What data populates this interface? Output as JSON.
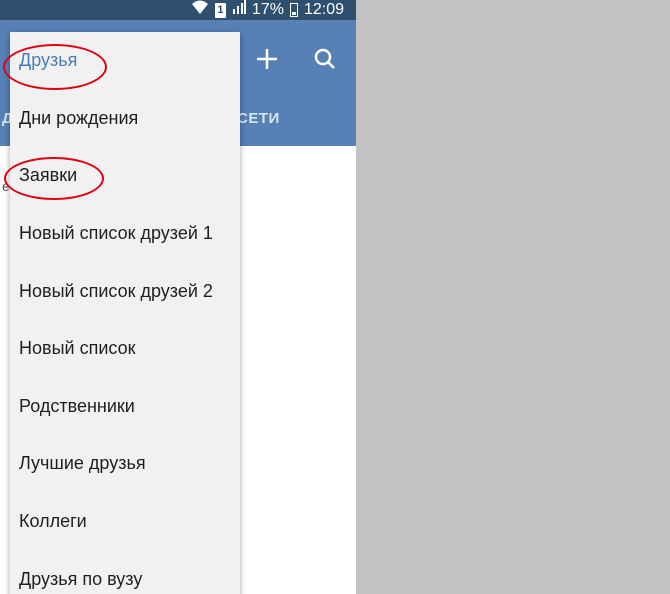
{
  "status_bar": {
    "sim_label": "1",
    "battery_percent": "17%",
    "time": "12:09",
    "icons": [
      "wifi-icon",
      "sim-icon",
      "signal-icon",
      "battery-icon"
    ]
  },
  "toolbar": {
    "add_icon": "plus-icon",
    "search_icon": "search-icon"
  },
  "tabs": {
    "left_partial": "Д",
    "right_partial": "СЕТИ"
  },
  "content": {
    "peek_text": "е"
  },
  "menu": {
    "items": [
      {
        "label": "Друзья"
      },
      {
        "label": "Дни рождения"
      },
      {
        "label": "Заявки"
      },
      {
        "label": "Новый список друзей 1"
      },
      {
        "label": "Новый список друзей 2"
      },
      {
        "label": "Новый список"
      },
      {
        "label": "Родственники"
      },
      {
        "label": "Лучшие друзья"
      },
      {
        "label": "Коллеги"
      },
      {
        "label": "Друзья по вузу"
      }
    ]
  },
  "colors": {
    "app_bar": "#5680b6",
    "status_bar": "#2f4f6f",
    "menu_background": "#f1f1f1",
    "selected_item": "#4a7db5",
    "annotation": "#e10012",
    "outside_background": "#c2c2c2"
  }
}
